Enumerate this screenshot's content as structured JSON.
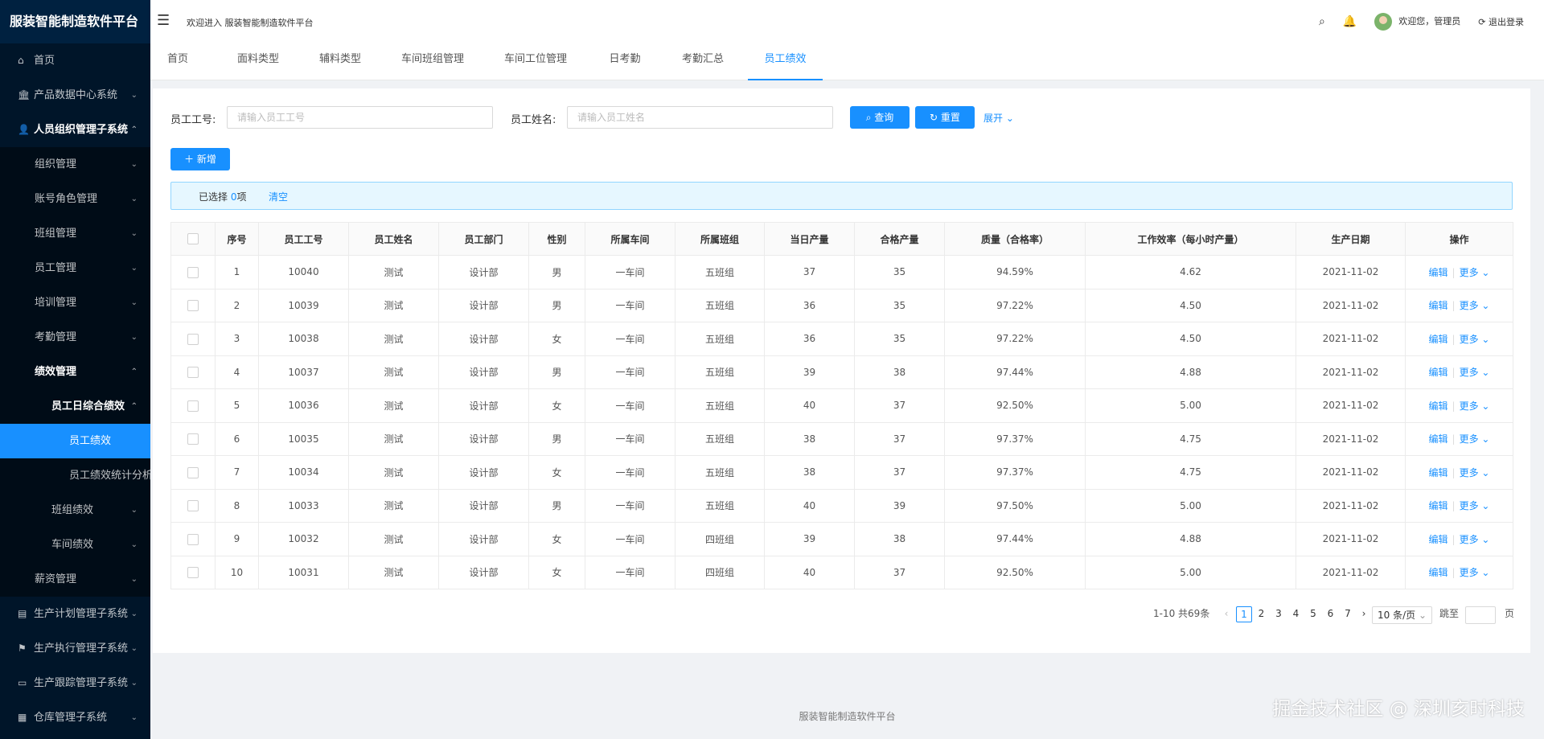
{
  "app": {
    "title": "服装智能制造软件平台"
  },
  "header": {
    "welcome": "欢迎进入 服装智能制造软件平台",
    "user_greeting": "欢迎您，管理员",
    "logout": "退出登录"
  },
  "sidebar": {
    "items": [
      {
        "label": "首页",
        "icon": "home-icon",
        "glyph": "⌂",
        "arrow": ""
      },
      {
        "label": "产品数据中心系统",
        "icon": "bank-icon",
        "glyph": "🏛",
        "arrow": "⌄"
      },
      {
        "label": "人员组织管理子系统",
        "icon": "user-icon",
        "glyph": "👤",
        "arrow": "⌃"
      },
      {
        "label": "组织管理",
        "arrow": "⌄"
      },
      {
        "label": "账号角色管理",
        "arrow": "⌄"
      },
      {
        "label": "班组管理",
        "arrow": "⌄"
      },
      {
        "label": "员工管理",
        "arrow": "⌄"
      },
      {
        "label": "培训管理",
        "arrow": "⌄"
      },
      {
        "label": "考勤管理",
        "arrow": "⌄"
      },
      {
        "label": "绩效管理",
        "arrow": "⌃"
      },
      {
        "label": "员工日综合绩效",
        "arrow": "⌃"
      },
      {
        "label": "员工绩效",
        "arrow": ""
      },
      {
        "label": "员工绩效统计分析",
        "arrow": ""
      },
      {
        "label": "班组绩效",
        "arrow": "⌄"
      },
      {
        "label": "车间绩效",
        "arrow": "⌄"
      },
      {
        "label": "薪资管理",
        "arrow": "⌄"
      },
      {
        "label": "生产计划管理子系统",
        "icon": "schedule-icon",
        "glyph": "▤",
        "arrow": "⌄"
      },
      {
        "label": "生产执行管理子系统",
        "icon": "flag-icon",
        "glyph": "⚑",
        "arrow": "⌄"
      },
      {
        "label": "生产跟踪管理子系统",
        "icon": "monitor-icon",
        "glyph": "▭",
        "arrow": "⌄"
      },
      {
        "label": "仓库管理子系统",
        "icon": "grid-icon",
        "glyph": "▦",
        "arrow": "⌄"
      }
    ]
  },
  "tabs": [
    "首页",
    "面料类型",
    "辅料类型",
    "车间班组管理",
    "车间工位管理",
    "日考勤",
    "考勤汇总",
    "员工绩效"
  ],
  "search": {
    "emp_no_label": "员工工号:",
    "emp_no_placeholder": "请输入员工工号",
    "emp_name_label": "员工姓名:",
    "emp_name_placeholder": "请输入员工姓名",
    "query_label": "查询",
    "reset_label": "重置",
    "expand_label": "展开"
  },
  "toolbar": {
    "add_label": "新增"
  },
  "selection": {
    "prefix": "已选择",
    "count": "0",
    "unit": "项",
    "clear": "清空"
  },
  "table": {
    "columns": [
      "序号",
      "员工工号",
      "员工姓名",
      "员工部门",
      "性别",
      "所属车间",
      "所属班组",
      "当日产量",
      "合格产量",
      "质量（合格率）",
      "工作效率（每小时产量）",
      "生产日期",
      "操作"
    ],
    "edit_label": "编辑",
    "more_label": "更多",
    "rows": [
      [
        "1",
        "10040",
        "测试",
        "设计部",
        "男",
        "一车间",
        "五班组",
        "37",
        "35",
        "94.59%",
        "4.62",
        "2021-11-02"
      ],
      [
        "2",
        "10039",
        "测试",
        "设计部",
        "男",
        "一车间",
        "五班组",
        "36",
        "35",
        "97.22%",
        "4.50",
        "2021-11-02"
      ],
      [
        "3",
        "10038",
        "测试",
        "设计部",
        "女",
        "一车间",
        "五班组",
        "36",
        "35",
        "97.22%",
        "4.50",
        "2021-11-02"
      ],
      [
        "4",
        "10037",
        "测试",
        "设计部",
        "男",
        "一车间",
        "五班组",
        "39",
        "38",
        "97.44%",
        "4.88",
        "2021-11-02"
      ],
      [
        "5",
        "10036",
        "测试",
        "设计部",
        "女",
        "一车间",
        "五班组",
        "40",
        "37",
        "92.50%",
        "5.00",
        "2021-11-02"
      ],
      [
        "6",
        "10035",
        "测试",
        "设计部",
        "男",
        "一车间",
        "五班组",
        "38",
        "37",
        "97.37%",
        "4.75",
        "2021-11-02"
      ],
      [
        "7",
        "10034",
        "测试",
        "设计部",
        "女",
        "一车间",
        "五班组",
        "38",
        "37",
        "97.37%",
        "4.75",
        "2021-11-02"
      ],
      [
        "8",
        "10033",
        "测试",
        "设计部",
        "男",
        "一车间",
        "五班组",
        "40",
        "39",
        "97.50%",
        "5.00",
        "2021-11-02"
      ],
      [
        "9",
        "10032",
        "测试",
        "设计部",
        "女",
        "一车间",
        "四班组",
        "39",
        "38",
        "97.44%",
        "4.88",
        "2021-11-02"
      ],
      [
        "10",
        "10031",
        "测试",
        "设计部",
        "女",
        "一车间",
        "四班组",
        "40",
        "37",
        "92.50%",
        "5.00",
        "2021-11-02"
      ]
    ]
  },
  "pagination": {
    "summary": "1-10 共69条",
    "pages": [
      "1",
      "2",
      "3",
      "4",
      "5",
      "6",
      "7"
    ],
    "current": "1",
    "page_size": "10 条/页",
    "jump_prefix": "跳至",
    "jump_suffix": "页"
  },
  "footer": {
    "text": "服装智能制造软件平台"
  },
  "watermark": {
    "text": "掘金技术社区 @ 深圳亥时科技"
  },
  "colors": {
    "primary": "#1890ff",
    "sidebar_bg": "#001529"
  }
}
